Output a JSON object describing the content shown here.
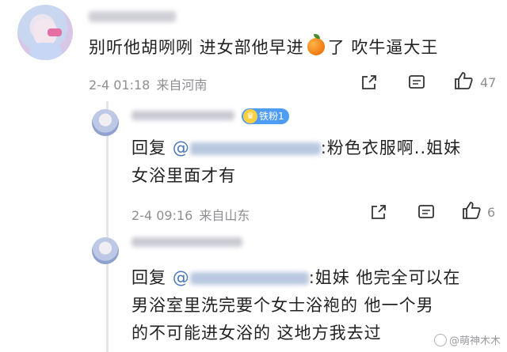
{
  "main_comment": {
    "text_before": "别听他胡咧咧 进女部他早进",
    "emoji": "orange-emoji",
    "text_after": "了 吹牛逼大王",
    "date": "2-4 01:18",
    "location": "来自河南",
    "like_count": "47"
  },
  "replies": [
    {
      "badge": "铁粉1",
      "reply_prefix": "回复",
      "at": "@",
      "text_line1": ":粉色衣服啊..姐妹",
      "text_line2": "女浴里面才有",
      "date": "2-4 09:16",
      "location": "来自山东",
      "like_count": "6"
    },
    {
      "reply_prefix": "回复",
      "at": "@",
      "text_line1": ":姐妹 他完全可以在",
      "text_line2": "男浴室里洗完要个女士浴袍的 他一个男",
      "text_line3": "的不可能进女浴的 这地方我去过"
    }
  ],
  "watermark": "@萌神木木",
  "colors": {
    "meta_gray": "#8e8e93",
    "mention_blue": "#4a76b8",
    "badge_blue": "#4f9cf5"
  }
}
